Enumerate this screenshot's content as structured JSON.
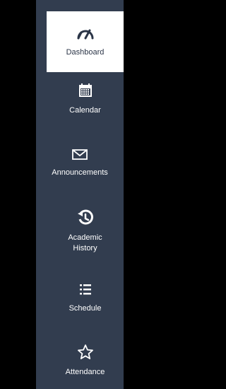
{
  "sidebar": {
    "items": [
      {
        "label": "Dashboard",
        "icon": "speedometer-icon",
        "active": true
      },
      {
        "label": "Calendar",
        "icon": "calendar-icon",
        "active": false
      },
      {
        "label": "Announcements",
        "icon": "envelope-icon",
        "active": false
      },
      {
        "label": "Academic History",
        "icon": "history-icon",
        "active": false
      },
      {
        "label": "Schedule",
        "icon": "list-icon",
        "active": false
      },
      {
        "label": "Attendance",
        "icon": "star-icon",
        "active": false
      }
    ]
  },
  "colors": {
    "sidebar_bg": "#323d4f",
    "active_bg": "#ffffff",
    "active_text": "#2b3547",
    "text": "#ffffff",
    "background": "#000000"
  }
}
